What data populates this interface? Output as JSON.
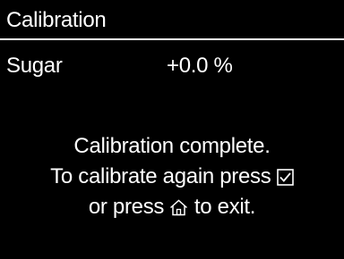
{
  "header": {
    "title": "Calibration"
  },
  "reading": {
    "label": "Sugar",
    "value": "+0.0 %"
  },
  "message": {
    "line1": "Calibration complete.",
    "line2_before_icon": "To calibrate again press",
    "line2_icon": "checkbox-checked-icon",
    "line3_before_icon": "or press",
    "line3_icon": "home-icon",
    "line3_after_icon": "to exit."
  },
  "colors": {
    "background": "#000000",
    "foreground": "#ffffff"
  }
}
